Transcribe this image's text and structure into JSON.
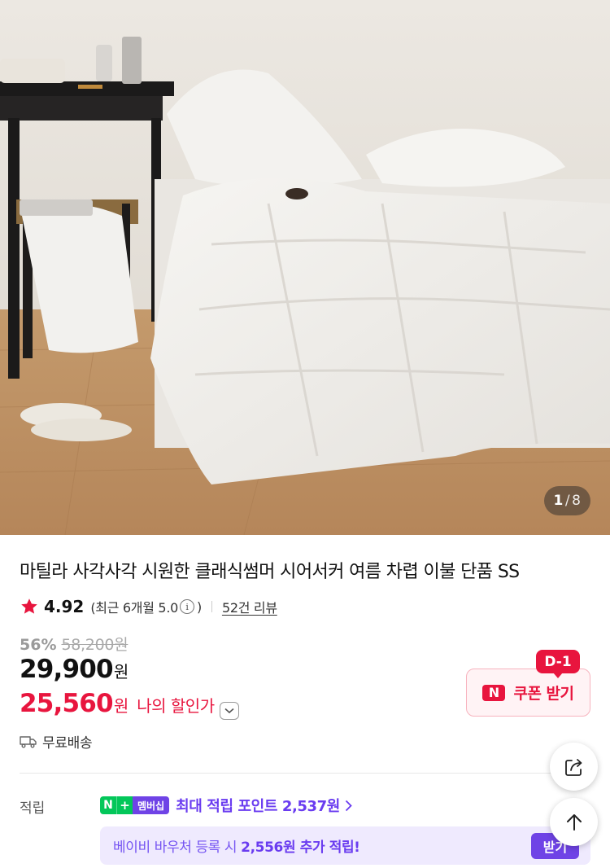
{
  "gallery": {
    "current": "1",
    "separator": "/",
    "total": "8"
  },
  "product": {
    "title": "마틸라 사각사각 시원한 클래식썸머 시어서커 여름 차렵 이불 단품 SS",
    "rating_score": "4.92",
    "rating_recent_prefix": "(최근 6개월 5.0",
    "rating_recent_suffix": ")",
    "review_link": "52건 리뷰",
    "discount_percent": "56%",
    "original_price": "58,200원",
    "price": "29,900",
    "price_unit": "원",
    "my_price": "25,560",
    "my_price_unit": "원",
    "my_price_label": "나의 할인가",
    "shipping": "무료배송"
  },
  "coupon": {
    "badge": "D-1",
    "logo": "N",
    "label": "쿠폰 받기"
  },
  "points": {
    "label": "적립",
    "badge_n": "N",
    "badge_plus": "+",
    "badge_membership": "멤버십",
    "max_points_text": "최대 적립 포인트 2,537원",
    "voucher_text": "베이비 바우처 등록 시",
    "voucher_bold": "2,556원 추가 적립!",
    "voucher_button": "받기"
  },
  "icons": {
    "rating": "star-icon",
    "info": "info-icon",
    "dropdown": "chevron-down-icon",
    "shipping": "truck-icon",
    "share": "share-icon",
    "top": "arrow-up-icon",
    "more": "chevron-right-icon"
  },
  "colors": {
    "sale": "#e8153e",
    "accent_purple": "#6f43e6",
    "naver_green": "#03c75a"
  }
}
